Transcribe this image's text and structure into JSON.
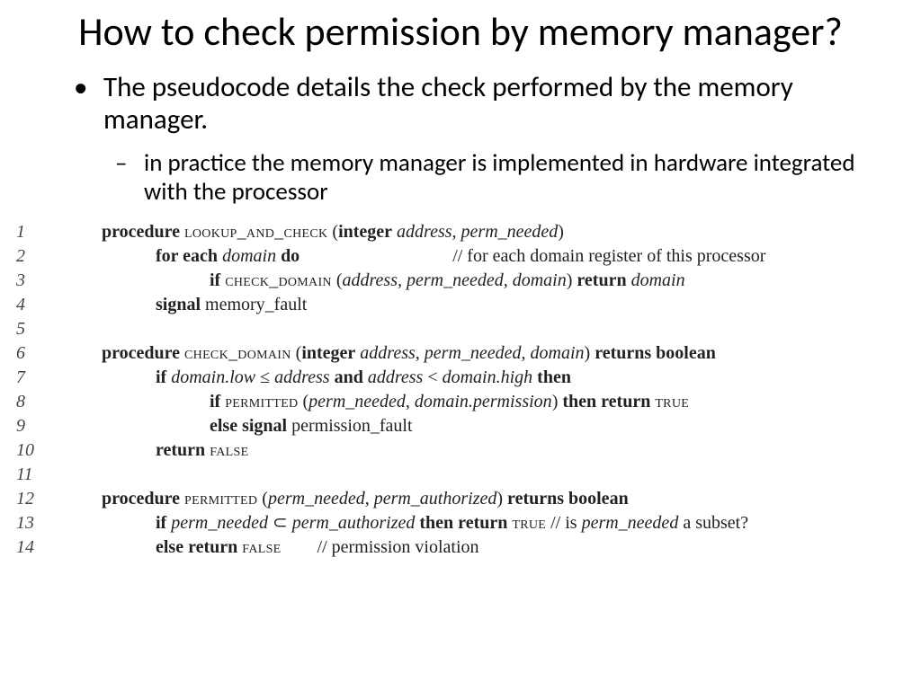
{
  "title": "How to check permission by memory manager?",
  "bullet_main": "The pseudocode details the check performed by the memory manager.",
  "bullet_sub": "in practice the memory manager is implemented in hardware integrated with the processor",
  "ln": {
    "l1": "1",
    "l2": "2",
    "l3": "3",
    "l4": "4",
    "l5": "5",
    "l6": "6",
    "l7": "7",
    "l8": "8",
    "l9": "9",
    "l10": "10",
    "l11": "11",
    "l12": "12",
    "l13": "13",
    "l14": "14"
  },
  "kw": {
    "procedure": "procedure",
    "for_each": "for each",
    "do": "do",
    "if": "if",
    "return": "return",
    "signal": "signal",
    "and": "and",
    "then": "then",
    "else_signal": "else signal",
    "else_return": "else return",
    "then_return": "then return",
    "returns_boolean": "returns boolean",
    "integer": "integer"
  },
  "sc": {
    "lookup": "lookup_and_check",
    "check_domain": "check_domain",
    "permitted": "permitted",
    "true": "true",
    "false": "false"
  },
  "it": {
    "address": "address",
    "perm_needed": "perm_needed",
    "domain": "domain",
    "address_perm_domain": "address, perm_needed, domain",
    "domain_low": "domain.low",
    "domain_high": "domain.high",
    "domain_permission": "domain.permission",
    "perm_authorized": "perm_authorized"
  },
  "txt": {
    "memory_fault": "memory_fault",
    "permission_fault": "permission_fault",
    "paren_open": " (",
    "paren_close": ")",
    "comma_sp": ", ",
    "sp": " ",
    "leq": " ≤ ",
    "lt": " < ",
    "subset": " ⊂ "
  },
  "cm": {
    "c2": "// for each domain register of this processor",
    "c13": "// is ",
    "c13b": " a subset?",
    "c14": "// permission violation"
  }
}
